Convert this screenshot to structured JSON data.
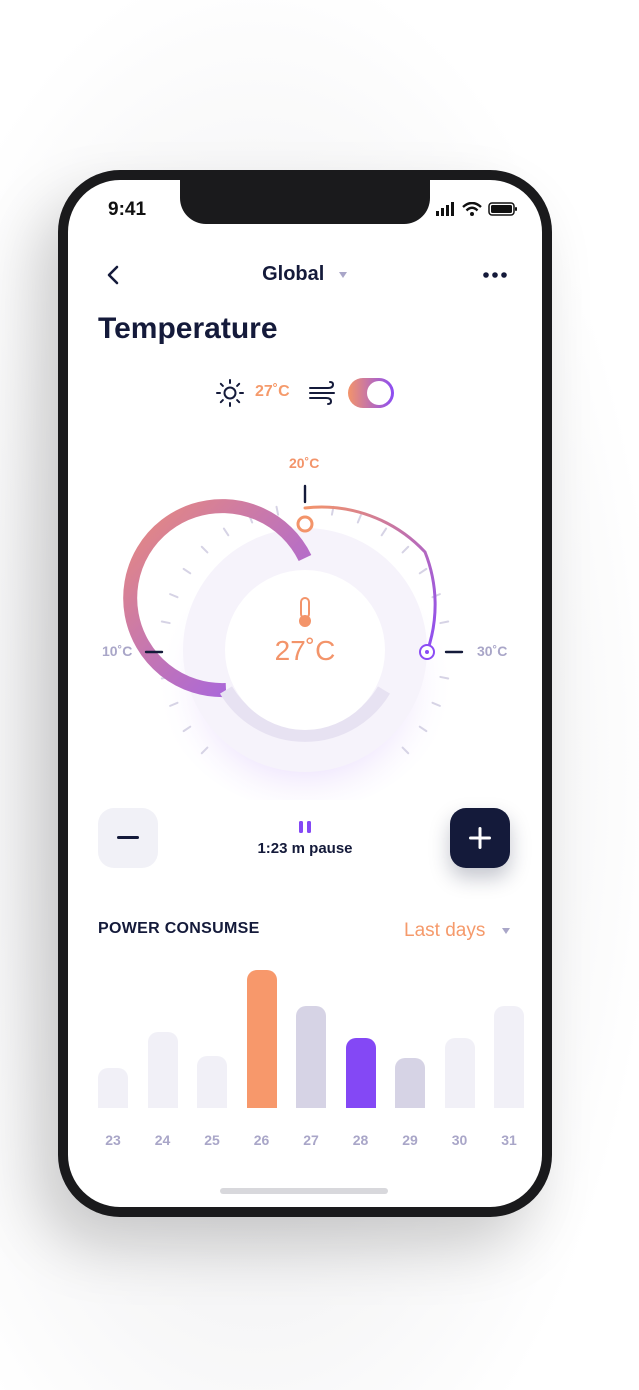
{
  "status_bar": {
    "time": "9:41"
  },
  "nav": {
    "title": "Global"
  },
  "page": {
    "title": "Temperature"
  },
  "weather": {
    "temp": "27˚C",
    "heat_on": true
  },
  "dial": {
    "top_label": "20˚C",
    "left_label": "10˚C",
    "right_label": "30˚C",
    "current": "27˚C",
    "min": 10,
    "max": 30,
    "set": 27
  },
  "controls": {
    "pause_text": "1:23 m pause"
  },
  "power": {
    "title": "POWER CONSUMSE",
    "period": "Last days"
  },
  "chart_data": {
    "type": "bar",
    "categories": [
      "23",
      "24",
      "25",
      "26",
      "27",
      "28",
      "29",
      "30",
      "31"
    ],
    "values": [
      20,
      38,
      26,
      69,
      51,
      35,
      25,
      35,
      51
    ],
    "highlight": {
      "26": "#f7986b",
      "28": "#8448f5"
    },
    "colors": {
      "muted": "#f1f0f7",
      "mid": "#d6d3e5"
    },
    "title": "",
    "xlabel": "",
    "ylabel": ""
  }
}
